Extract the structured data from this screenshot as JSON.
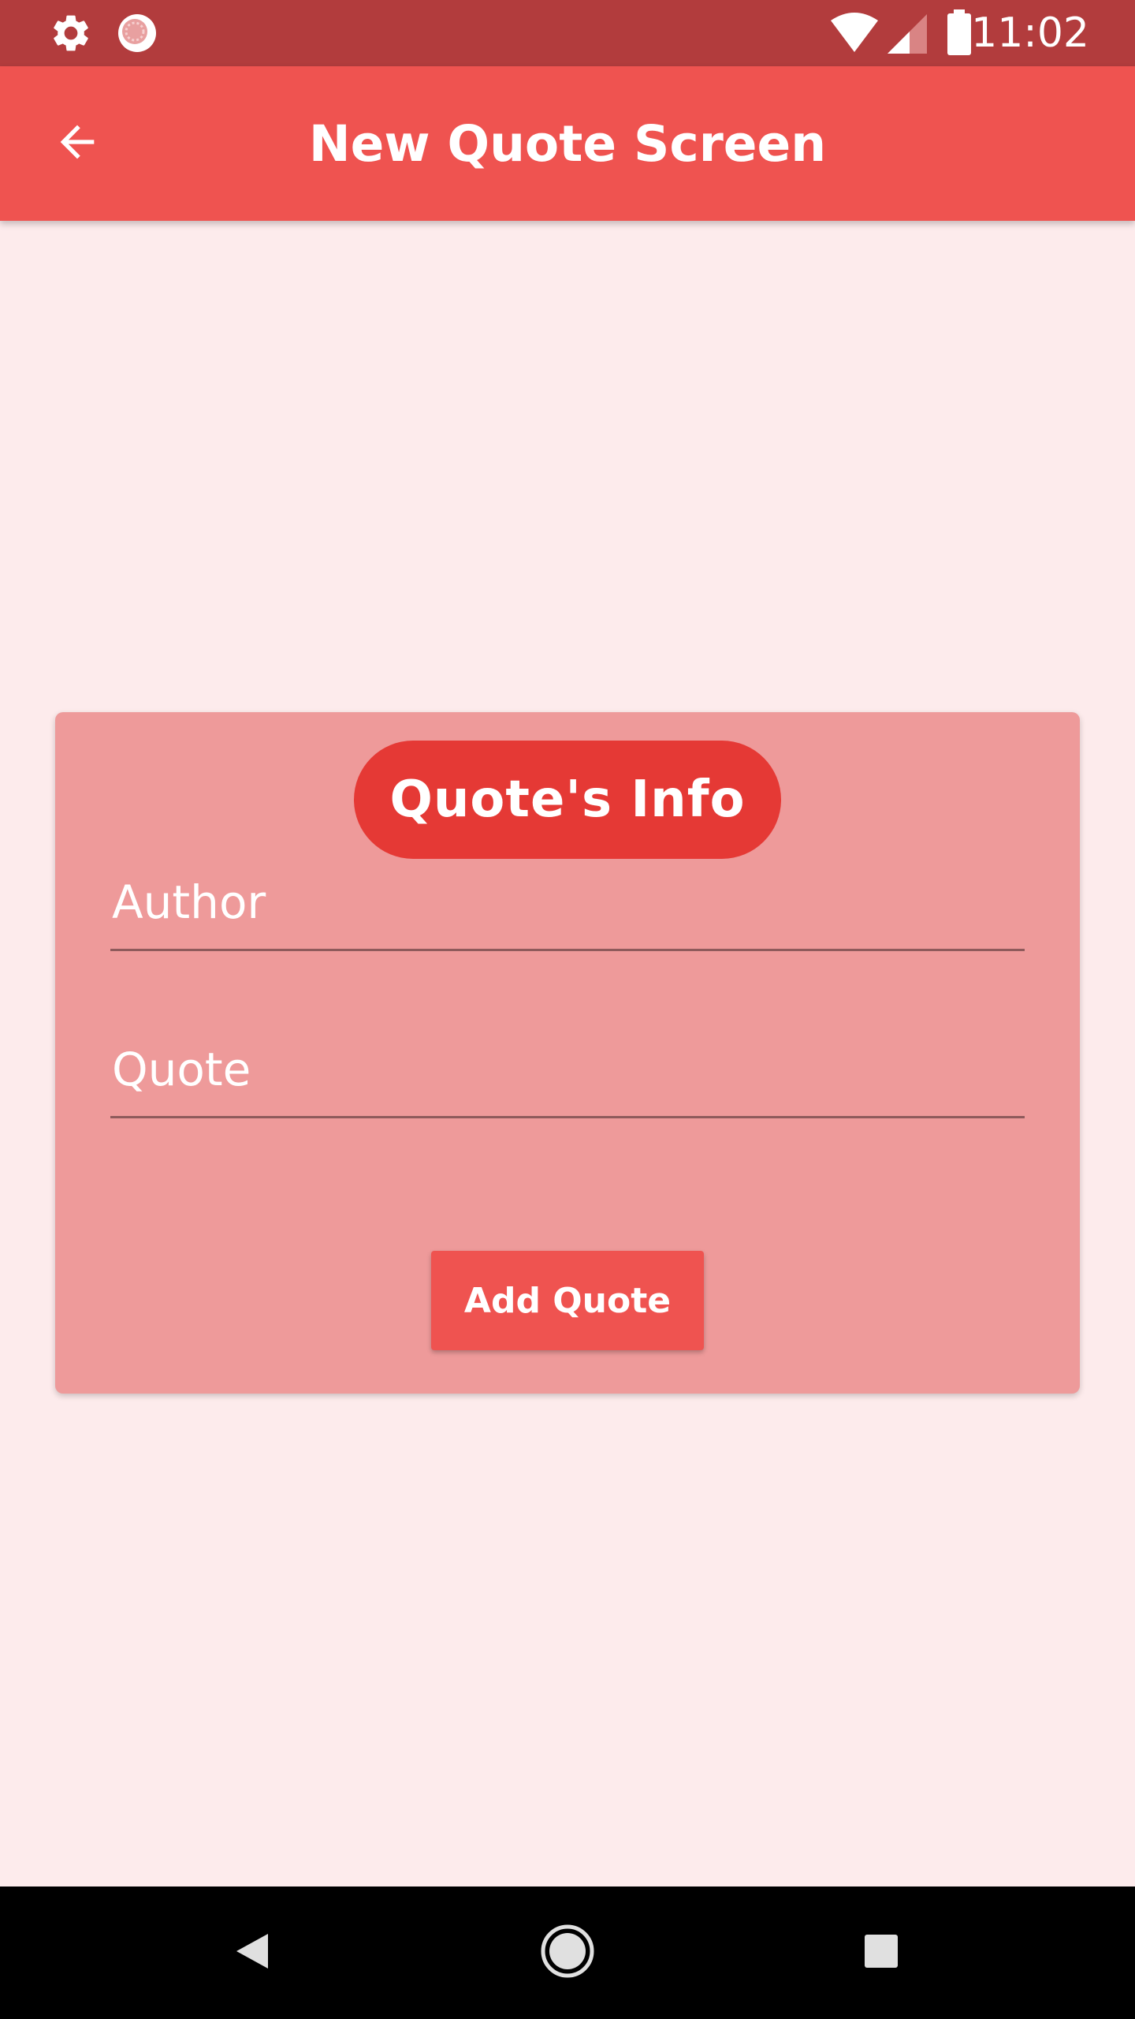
{
  "status_bar": {
    "time": "11:02",
    "left_icons": [
      "gear-icon",
      "sync-icon"
    ],
    "right_icons": [
      "wifi-icon",
      "signal-icon",
      "battery-icon"
    ]
  },
  "app_bar": {
    "title": "New Quote Screen",
    "back_icon": "arrow-back-icon"
  },
  "card": {
    "header": "Quote's Info",
    "fields": [
      {
        "label": "Author",
        "value": ""
      },
      {
        "label": "Quote",
        "value": ""
      }
    ],
    "submit_label": "Add Quote"
  },
  "nav_bar": {
    "buttons": [
      "back-triangle-icon",
      "home-circle-icon",
      "recents-square-icon"
    ]
  },
  "colors": {
    "status_bar": "#B23C3D",
    "app_bar": "#EF5350",
    "background": "#FDEBEC",
    "card": "#EE9A9A",
    "pill": "#E53935",
    "button": "#EF5350"
  }
}
